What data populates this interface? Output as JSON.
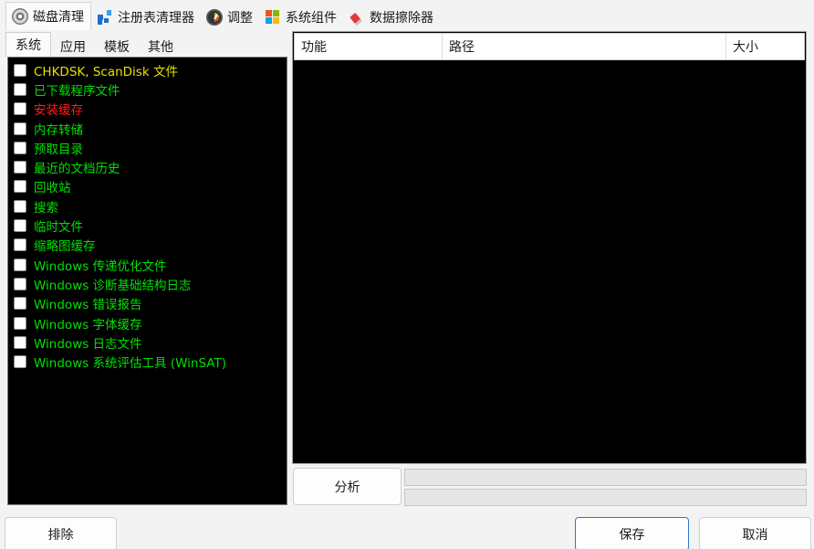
{
  "top_tabs": [
    {
      "label": "磁盘清理",
      "icon": "disk-icon",
      "active": true
    },
    {
      "label": "注册表清理器",
      "icon": "registry-icon",
      "active": false
    },
    {
      "label": "调整",
      "icon": "gauge-icon",
      "active": false
    },
    {
      "label": "系统组件",
      "icon": "windows-logo-icon",
      "active": false
    },
    {
      "label": "数据擦除器",
      "icon": "eraser-icon",
      "active": false
    }
  ],
  "sub_tabs": [
    {
      "label": "系统",
      "active": true
    },
    {
      "label": "应用",
      "active": false
    },
    {
      "label": "模板",
      "active": false
    },
    {
      "label": "其他",
      "active": false
    }
  ],
  "items": [
    {
      "label": "CHKDSK, ScanDisk 文件",
      "color": "#e5e000",
      "checked": false
    },
    {
      "label": "已下载程序文件",
      "color": "#00e000",
      "checked": false
    },
    {
      "label": "安装缓存",
      "color": "#ff1a1a",
      "checked": false
    },
    {
      "label": "内存转储",
      "color": "#00e000",
      "checked": false
    },
    {
      "label": "预取目录",
      "color": "#00e000",
      "checked": false
    },
    {
      "label": "最近的文档历史",
      "color": "#00e000",
      "checked": false
    },
    {
      "label": "回收站",
      "color": "#00e000",
      "checked": false
    },
    {
      "label": "搜索",
      "color": "#00e000",
      "checked": false
    },
    {
      "label": "临时文件",
      "color": "#00e000",
      "checked": false
    },
    {
      "label": "缩略图缓存",
      "color": "#00e000",
      "checked": false
    },
    {
      "label": "Windows 传递优化文件",
      "color": "#00e000",
      "checked": false
    },
    {
      "label": "Windows 诊断基础结构日志",
      "color": "#00e000",
      "checked": false
    },
    {
      "label": "Windows 错误报告",
      "color": "#00e000",
      "checked": false
    },
    {
      "label": "Windows 字体缓存",
      "color": "#00e000",
      "checked": false
    },
    {
      "label": "Windows 日志文件",
      "color": "#00e000",
      "checked": false
    },
    {
      "label": "Windows 系统评估工具 (WinSAT)",
      "color": "#00e000",
      "checked": false
    }
  ],
  "table": {
    "columns": [
      "功能",
      "路径",
      "大小"
    ],
    "rows": []
  },
  "analyze_label": "分析",
  "progress": [
    0,
    0
  ],
  "footer": {
    "exclude_label": "排除",
    "save_label": "保存",
    "cancel_label": "取消"
  }
}
